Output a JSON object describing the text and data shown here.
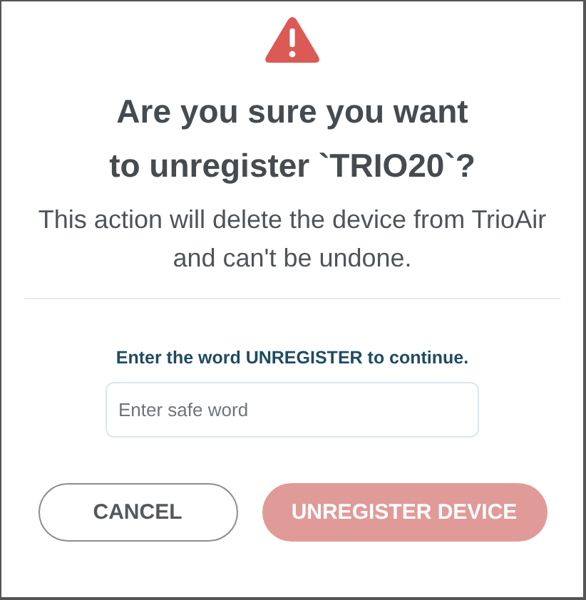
{
  "dialog": {
    "title_lines": [
      "Are you sure you want",
      "to unregister `TRIO20`?"
    ],
    "message_lines": [
      "This action will delete the device from TrioAir",
      "and can't be undone."
    ],
    "prompt": "Enter the word UNREGISTER to continue.",
    "input": {
      "placeholder": "Enter safe word"
    },
    "buttons": [
      {
        "label": "CANCEL",
        "kind": "secondary",
        "disabled": false
      },
      {
        "label": "UNREGISTER DEVICE",
        "kind": "danger",
        "disabled": true
      }
    ]
  }
}
